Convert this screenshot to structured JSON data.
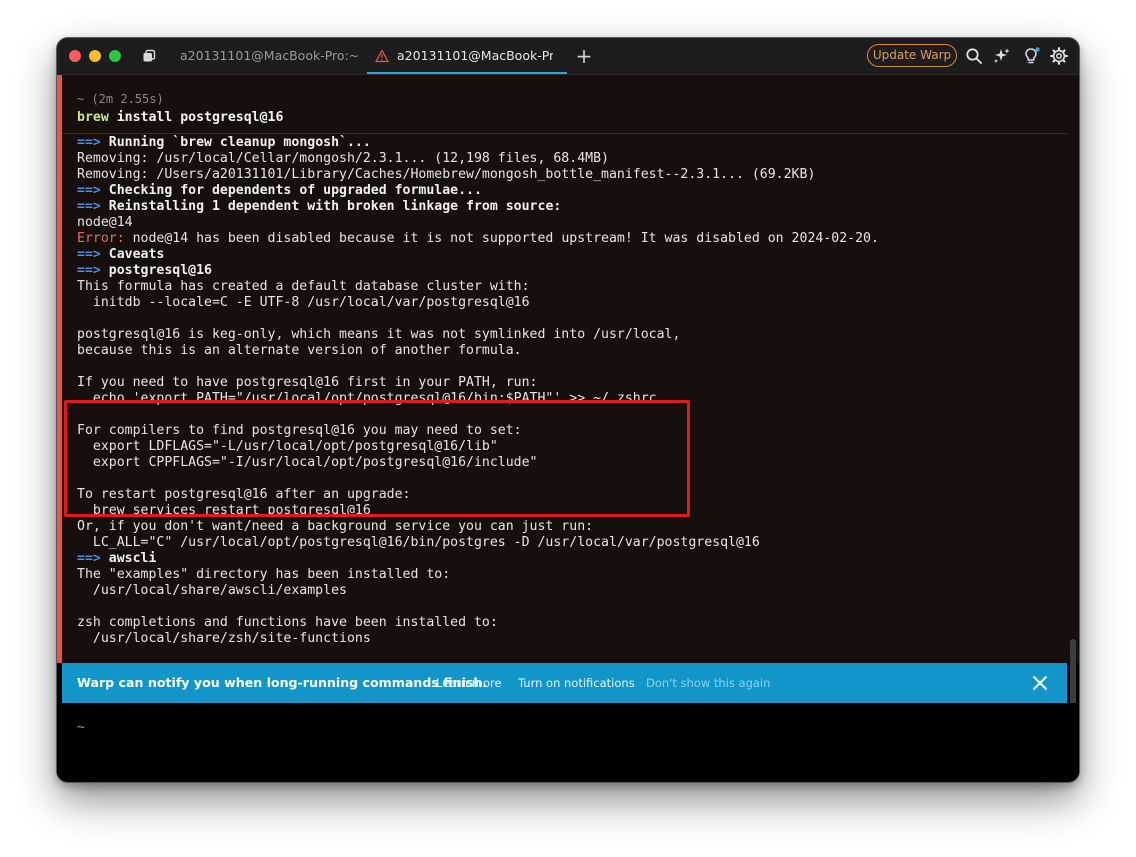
{
  "tabs": [
    {
      "label": "a20131101@MacBook-Pro:~",
      "active": false
    },
    {
      "label": "a20131101@MacBook-Pro:",
      "active": true
    }
  ],
  "new_tab": "+",
  "update_button": "Update Warp",
  "toolbar_icons": [
    "search-icon",
    "sparkles-icon",
    "lightbulb-icon",
    "gear-icon"
  ],
  "block": {
    "meta": "~ (2m 2.55s)",
    "command_keyword": "brew",
    "command_rest": " install postgresql@16"
  },
  "output": [
    {
      "arrow": "==> ",
      "text": "Running `brew cleanup mongosh`...",
      "style": "bold"
    },
    {
      "text": "Removing: /usr/local/Cellar/mongosh/2.3.1... (12,198 files, 68.4MB)"
    },
    {
      "text": "Removing: /Users/a20131101/Library/Caches/Homebrew/mongosh_bottle_manifest--2.3.1... (69.2KB)"
    },
    {
      "arrow": "==> ",
      "text": "Checking for dependents of upgraded formulae...",
      "style": "bold"
    },
    {
      "arrow": "==> ",
      "text": "Reinstalling 1 dependent with broken linkage from source:",
      "style": "bold"
    },
    {
      "text": "node@14"
    },
    {
      "err": "Error:",
      "text": " node@14 has been disabled because it is not supported upstream! It was disabled on 2024-02-20."
    },
    {
      "arrow": "==> ",
      "text": "Caveats",
      "style": "bold"
    },
    {
      "arrow": "==> ",
      "text": "postgresql@16",
      "style": "bold"
    },
    {
      "text": "This formula has created a default database cluster with:"
    },
    {
      "text": "  initdb --locale=C -E UTF-8 /usr/local/var/postgresql@16"
    },
    {
      "text": ""
    },
    {
      "text": "postgresql@16 is keg-only, which means it was not symlinked into /usr/local,"
    },
    {
      "text": "because this is an alternate version of another formula."
    },
    {
      "text": ""
    },
    {
      "text": "If you need to have postgresql@16 first in your PATH, run:"
    },
    {
      "text": "  echo 'export PATH=\"/usr/local/opt/postgresql@16/bin:$PATH\"' >> ~/.zshrc"
    },
    {
      "text": ""
    },
    {
      "text": "For compilers to find postgresql@16 you may need to set:"
    },
    {
      "text": "  export LDFLAGS=\"-L/usr/local/opt/postgresql@16/lib\""
    },
    {
      "text": "  export CPPFLAGS=\"-I/usr/local/opt/postgresql@16/include\""
    },
    {
      "text": ""
    },
    {
      "text": "To restart postgresql@16 after an upgrade:"
    },
    {
      "text": "  brew services restart postgresql@16"
    },
    {
      "text": "Or, if you don't want/need a background service you can just run:"
    },
    {
      "text": "  LC_ALL=\"C\" /usr/local/opt/postgresql@16/bin/postgres -D /usr/local/var/postgresql@16"
    },
    {
      "arrow": "==> ",
      "text": "awscli",
      "style": "bold"
    },
    {
      "text": "The \"examples\" directory has been installed to:"
    },
    {
      "text": "  /usr/local/share/awscli/examples"
    },
    {
      "text": ""
    },
    {
      "text": "zsh completions and functions have been installed to:"
    },
    {
      "text": "  /usr/local/share/zsh/site-functions"
    }
  ],
  "notification": {
    "message": "Warp can notify you when long-running commands finish.",
    "learn_more": "Learn more",
    "turn_on": "Turn on notifications",
    "dont_show": "Don't show this again"
  },
  "prompt": "~",
  "colors": {
    "accent_blue": "#1296c9",
    "error": "#ea6e5b",
    "arrow": "#4c8fe6",
    "highlight": "#dd1d1d",
    "update": "#e39c4b"
  }
}
